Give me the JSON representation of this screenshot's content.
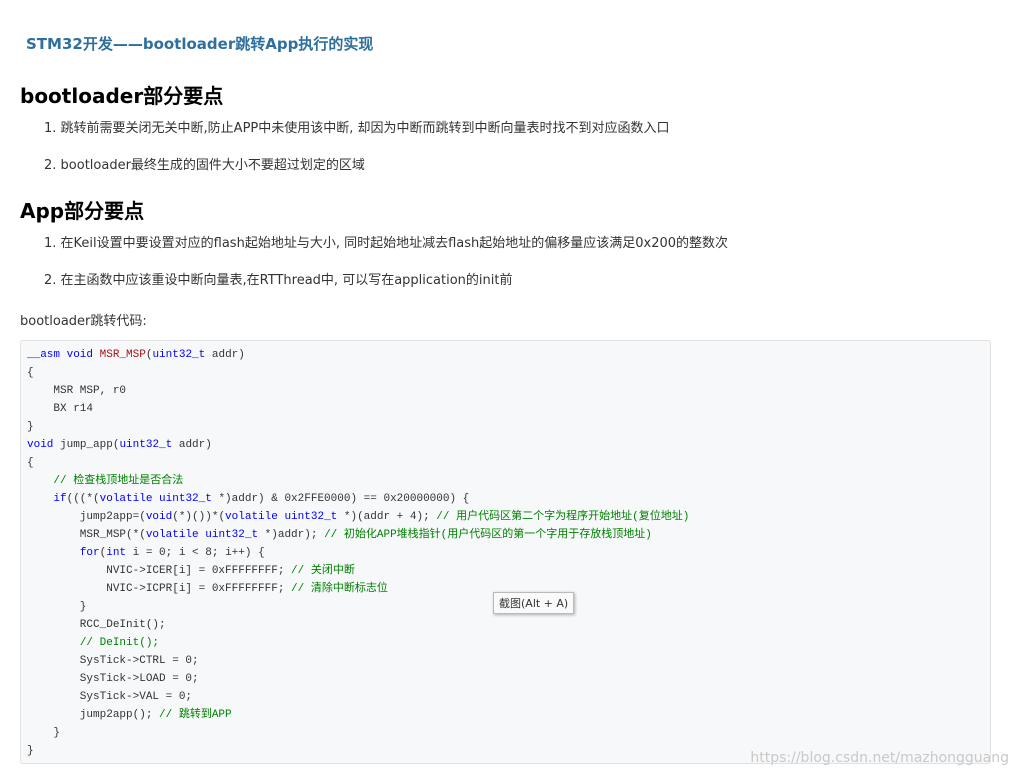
{
  "article": {
    "title": "STM32开发——bootloader跳转App执行的实现",
    "sections": [
      {
        "heading": "bootloader部分要点",
        "items": [
          "跳转前需要关闭无关中断,防止APP中未使用该中断, 却因为中断而跳转到中断向量表时找不到对应函数入口",
          "bootloader最终生成的固件大小不要超过划定的区域"
        ]
      },
      {
        "heading": "App部分要点",
        "items": [
          "在Keil设置中要设置对应的flash起始地址与大小, 同时起始地址减去flash起始地址的偏移量应该满足0x200的整数次",
          "在主函数中应该重设中断向量表,在RTThread中, 可以写在application的init前"
        ]
      }
    ],
    "code_caption": "bootloader跳转代码:",
    "code_lines": [
      [
        {
          "t": "__asm void ",
          "c": "kw"
        },
        {
          "t": "MSR_MSP",
          "c": "fn"
        },
        {
          "t": "("
        },
        {
          "t": "uint32_t",
          "c": "kw"
        },
        {
          "t": " addr)"
        }
      ],
      [
        {
          "t": "{"
        }
      ],
      [
        {
          "t": "    MSR MSP, r0"
        }
      ],
      [
        {
          "t": "    BX r14"
        }
      ],
      [
        {
          "t": "}"
        }
      ],
      [
        {
          "t": "void ",
          "c": "kw"
        },
        {
          "t": "jump_app"
        },
        {
          "t": "("
        },
        {
          "t": "uint32_t",
          "c": "kw"
        },
        {
          "t": " addr)"
        }
      ],
      [
        {
          "t": "{"
        }
      ],
      [
        {
          "t": "    "
        },
        {
          "t": "// 检查栈顶地址是否合法",
          "c": "cm"
        }
      ],
      [
        {
          "t": "    "
        },
        {
          "t": "if",
          "c": "kw"
        },
        {
          "t": "(((*("
        },
        {
          "t": "volatile uint32_t",
          "c": "kw"
        },
        {
          "t": " *)addr) & 0x2FFE0000) == 0x20000000) {"
        }
      ],
      [
        {
          "t": "        jump2app=("
        },
        {
          "t": "void",
          "c": "kw"
        },
        {
          "t": "(*)())*("
        },
        {
          "t": "volatile uint32_t",
          "c": "kw"
        },
        {
          "t": " *)(addr + 4); "
        },
        {
          "t": "// 用户代码区第二个字为程序开始地址(复位地址)",
          "c": "cm"
        }
      ],
      [
        {
          "t": "        MSR_MSP(*("
        },
        {
          "t": "volatile uint32_t",
          "c": "kw"
        },
        {
          "t": " *)addr); "
        },
        {
          "t": "// 初始化APP堆栈指针(用户代码区的第一个字用于存放栈顶地址)",
          "c": "cm"
        }
      ],
      [
        {
          "t": "        "
        },
        {
          "t": "for",
          "c": "kw"
        },
        {
          "t": "("
        },
        {
          "t": "int",
          "c": "kw"
        },
        {
          "t": " i = 0; i < 8; i++) {"
        }
      ],
      [
        {
          "t": "            NVIC->ICER[i] = 0xFFFFFFFF; "
        },
        {
          "t": "// 关闭中断",
          "c": "cm"
        }
      ],
      [
        {
          "t": "            NVIC->ICPR[i] = 0xFFFFFFFF; "
        },
        {
          "t": "// 清除中断标志位",
          "c": "cm"
        }
      ],
      [
        {
          "t": "        }"
        }
      ],
      [
        {
          "t": "        RCC_DeInit();"
        }
      ],
      [
        {
          "t": "        "
        },
        {
          "t": "// DeInit();",
          "c": "cm"
        }
      ],
      [
        {
          "t": "        SysTick->CTRL = 0;"
        }
      ],
      [
        {
          "t": "        SysTick->LOAD = 0;"
        }
      ],
      [
        {
          "t": "        SysTick->VAL = 0;"
        }
      ],
      [
        {
          "t": "        jump2app(); "
        },
        {
          "t": "// 跳转到APP",
          "c": "cm"
        }
      ],
      [
        {
          "t": "    }"
        }
      ],
      [
        {
          "t": "}"
        }
      ]
    ]
  },
  "tooltip": "截图(Alt + A)",
  "watermark": "https://blog.csdn.net/mazhongguang"
}
